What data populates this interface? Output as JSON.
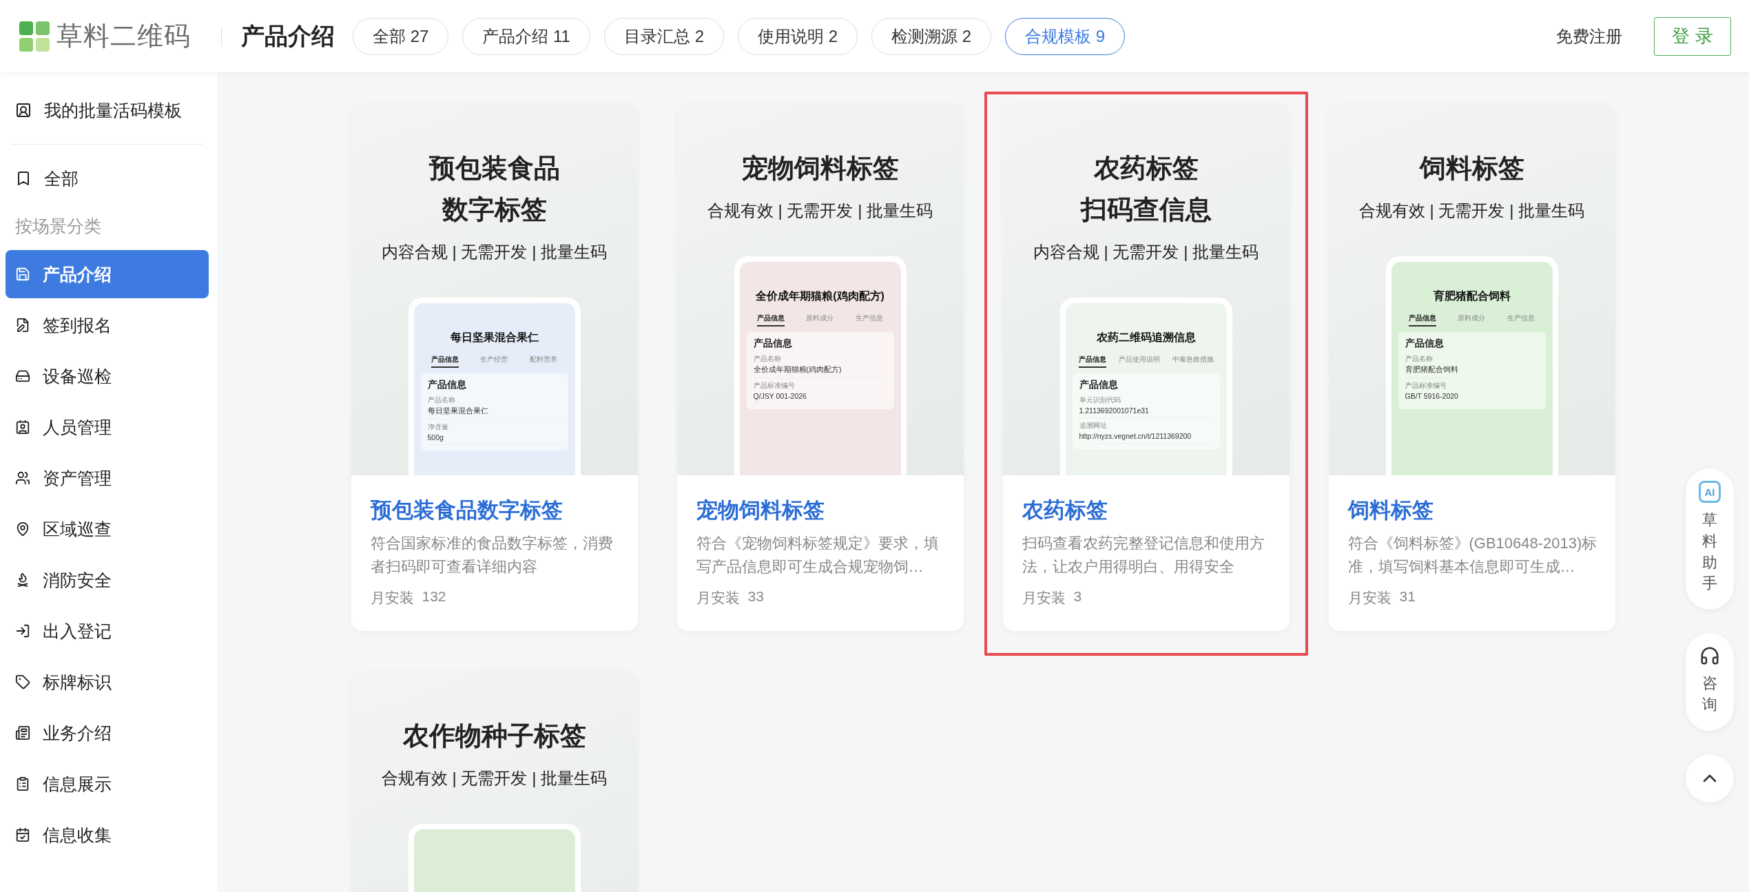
{
  "header": {
    "logo_text": "草料二维码",
    "page_title": "产品介绍",
    "filters": [
      {
        "label": "全部 27",
        "selected": false
      },
      {
        "label": "产品介绍 11",
        "selected": false
      },
      {
        "label": "目录汇总 2",
        "selected": false
      },
      {
        "label": "使用说明 2",
        "selected": false
      },
      {
        "label": "检测溯源 2",
        "selected": false
      },
      {
        "label": "合规模板 9",
        "selected": true
      }
    ],
    "register_link": "免费注册",
    "login_button": "登 录"
  },
  "sidebar": {
    "top_item": "我的批量活码模板",
    "all_item": {
      "label": "全部",
      "selected": false
    },
    "section_label": "按场景分类",
    "categories": [
      {
        "label": "产品介绍",
        "selected": true
      },
      {
        "label": "签到报名",
        "selected": false
      },
      {
        "label": "设备巡检",
        "selected": false
      },
      {
        "label": "人员管理",
        "selected": false
      },
      {
        "label": "资产管理",
        "selected": false
      },
      {
        "label": "区域巡查",
        "selected": false
      },
      {
        "label": "消防安全",
        "selected": false
      },
      {
        "label": "出入登记",
        "selected": false
      },
      {
        "label": "标牌标识",
        "selected": false
      },
      {
        "label": "业务介绍",
        "selected": false
      },
      {
        "label": "信息展示",
        "selected": false
      },
      {
        "label": "信息收集",
        "selected": false
      }
    ]
  },
  "cards": [
    {
      "highlighted": false,
      "poster_title": [
        "预包装食品",
        "数字标签"
      ],
      "tagline": "内容合规 | 无需开发 | 批量生码",
      "phone": {
        "color": "#e6edf8",
        "title": "每日坚果混合果仁",
        "tabs": [
          {
            "label": "产品信息",
            "selected": true
          },
          {
            "label": "生产经营",
            "selected": false
          },
          {
            "label": "配料营养",
            "selected": false
          }
        ],
        "section": "产品信息",
        "fields": [
          {
            "label": "产品名称",
            "value": "每日坚果混合果仁"
          },
          {
            "label": "净含量",
            "value": "500g"
          }
        ]
      },
      "title": "预包装食品数字标签",
      "description": "符合国家标准的食品数字标签，消费者扫码即可查看详细内容",
      "installs_label": "月安装",
      "installs": "132"
    },
    {
      "highlighted": false,
      "poster_title": [
        "宠物饲料标签"
      ],
      "tagline": "合规有效 | 无需开发 | 批量生码",
      "phone": {
        "color": "#f3e6e6",
        "title": "全价成年期猫粮(鸡肉配方)",
        "tabs": [
          {
            "label": "产品信息",
            "selected": true
          },
          {
            "label": "原料成分",
            "selected": false
          },
          {
            "label": "生产信息",
            "selected": false
          }
        ],
        "section": "产品信息",
        "fields": [
          {
            "label": "产品名称",
            "value": "全价成年期猫粮(鸡肉配方)"
          },
          {
            "label": "产品标准编号",
            "value": "Q/JSY 001-2026"
          }
        ]
      },
      "title": "宠物饲料标签",
      "description": "符合《宠物饲料标签规定》要求，填写产品信息即可生成合规宠物饲…",
      "installs_label": "月安装",
      "installs": "33"
    },
    {
      "highlighted": true,
      "poster_title": [
        "农药标签",
        "扫码查信息"
      ],
      "tagline": "内容合规 | 无需开发 | 批量生码",
      "phone": {
        "color": "#edf5ee",
        "title": "农药二维码追溯信息",
        "tabs": [
          {
            "label": "产品信息",
            "selected": true
          },
          {
            "label": "产品使用说明",
            "selected": false
          },
          {
            "label": "中毒急救措施",
            "selected": false
          }
        ],
        "section": "产品信息",
        "fields": [
          {
            "label": "单元识别代码",
            "value": "1.2113692001071e31"
          },
          {
            "label": "追溯网址",
            "value": "http://nyzs.vegnet.cn/t/1211369200"
          }
        ]
      },
      "title": "农药标签",
      "description": "扫码查看农药完整登记信息和使用方法，让农户用得明白、用得安全",
      "installs_label": "月安装",
      "installs": "3"
    },
    {
      "highlighted": false,
      "poster_title": [
        "饲料标签"
      ],
      "tagline": "合规有效 | 无需开发 | 批量生码",
      "phone": {
        "color": "#d9efd6",
        "title": "育肥猪配合饲料",
        "tabs": [
          {
            "label": "产品信息",
            "selected": true
          },
          {
            "label": "原料成分",
            "selected": false
          },
          {
            "label": "生产信息",
            "selected": false
          }
        ],
        "section": "产品信息",
        "fields": [
          {
            "label": "产品名称",
            "value": "育肥猪配合饲料"
          },
          {
            "label": "产品标准编号",
            "value": "GB/T 5916-2020"
          }
        ]
      },
      "title": "饲料标签",
      "description": "符合《饲料标签》(GB10648-2013)标准，填写饲料基本信息即可生成…",
      "installs_label": "月安装",
      "installs": "31"
    },
    {
      "highlighted": false,
      "poster_title": [
        "农作物种子标签"
      ],
      "tagline": "合规有效 | 无需开发 | 批量生码",
      "phone": {
        "color": "#dcedd6"
      }
    }
  ],
  "float_tools": {
    "ai_badge": "AI",
    "assistant_label": "草料助手",
    "consult_label": "咨询"
  }
}
